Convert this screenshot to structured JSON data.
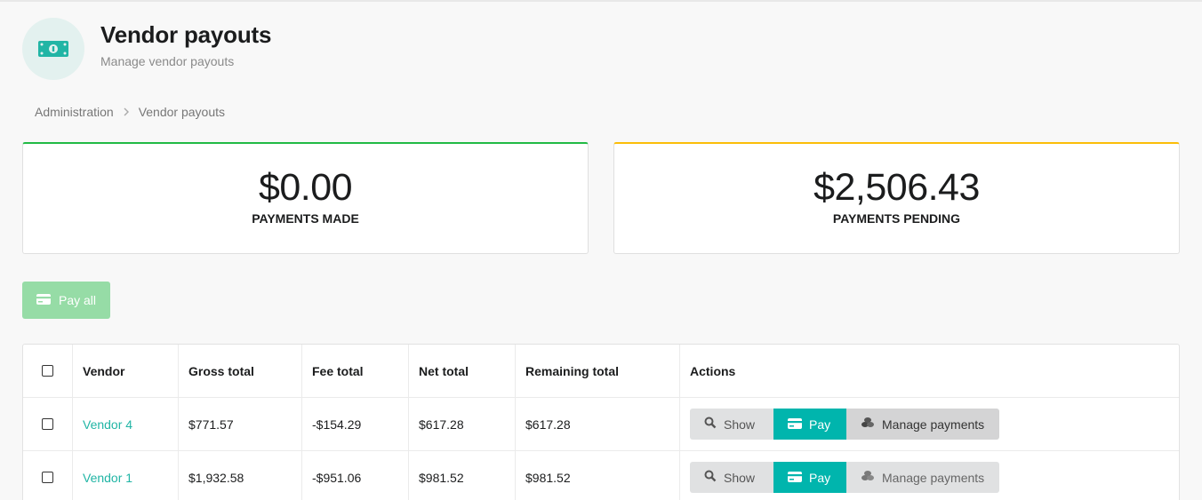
{
  "header": {
    "title": "Vendor payouts",
    "subtitle": "Manage vendor payouts",
    "icon": "money-bill-icon",
    "icon_color": "#21b5a5"
  },
  "breadcrumb": {
    "items": [
      "Administration",
      "Vendor payouts"
    ]
  },
  "stats": {
    "made": {
      "value": "$0.00",
      "label": "PAYMENTS MADE",
      "accent": "#21ba45"
    },
    "pending": {
      "value": "$2,506.43",
      "label": "PAYMENTS PENDING",
      "accent": "#fbbd08"
    }
  },
  "actions": {
    "pay_all_label": "Pay all"
  },
  "table": {
    "columns": [
      "Vendor",
      "Gross total",
      "Fee total",
      "Net total",
      "Remaining total",
      "Actions"
    ],
    "rows": [
      {
        "vendor": "Vendor 4",
        "gross": "$771.57",
        "fee": "-$154.29",
        "net": "$617.28",
        "remaining": "$617.28",
        "show": "Show",
        "pay": "Pay",
        "manage": "Manage payments"
      },
      {
        "vendor": "Vendor 1",
        "gross": "$1,932.58",
        "fee": "-$951.06",
        "net": "$981.52",
        "remaining": "$981.52",
        "show": "Show",
        "pay": "Pay",
        "manage": "Manage payments"
      }
    ]
  }
}
